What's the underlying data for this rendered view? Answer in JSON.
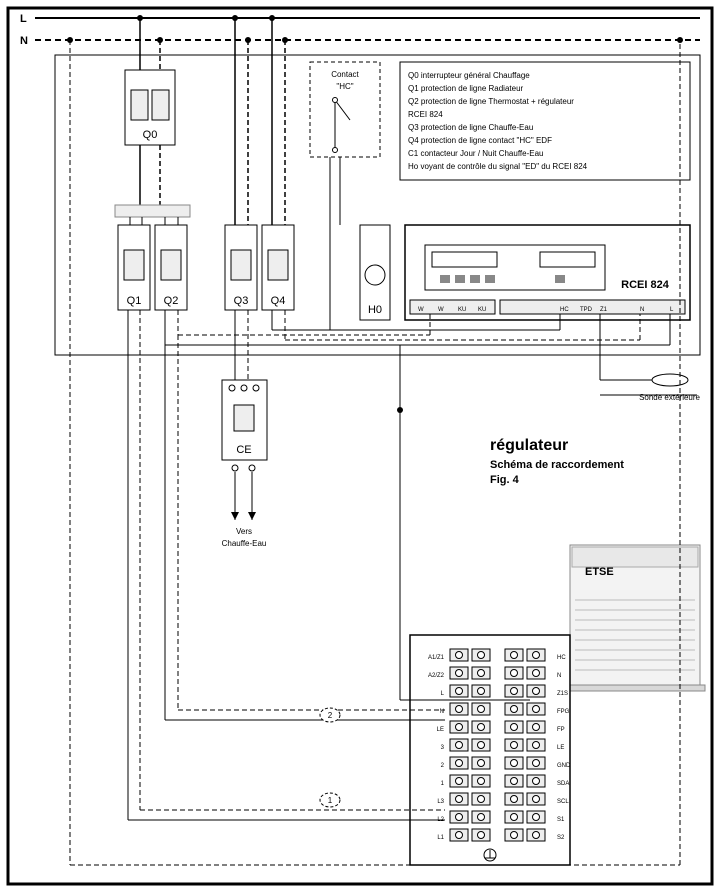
{
  "rails": {
    "L": "L",
    "N": "N"
  },
  "breakers": {
    "Q0": "Q0",
    "Q1": "Q1",
    "Q2": "Q2",
    "Q3": "Q3",
    "Q4": "Q4",
    "CE": "CE",
    "H0": "H0"
  },
  "contactHC": {
    "title1": "Contact",
    "title2": "\"HC\""
  },
  "legend": {
    "l1": "Q0  interrupteur général Chauffage",
    "l2": "Q1  protection de ligne Radiateur",
    "l3": "Q2  protection de ligne Thermostat + régulateur",
    "l4": "RCEI 824",
    "l5": "Q3  protection de ligne Chauffe-Eau",
    "l6": "Q4  protection de ligne contact \"HC\" EDF",
    "l7": "C1 contacteur Jour / Nuit Chauffe-Eau",
    "l8": "Ho voyant de contrôle du signal \"ED\" du RCEI 824"
  },
  "controller": {
    "name": "RCEI 824",
    "leftTerms": [
      "W",
      "W",
      "KU",
      "KU"
    ],
    "rightTerms": [
      "HC",
      "TPD",
      "Z1",
      "",
      "N",
      "",
      "L"
    ]
  },
  "sonde": "Sonde extérieure",
  "title": {
    "t1": "régulateur",
    "t2": "Schéma de raccordement",
    "t3": "Fig. 4"
  },
  "heater": "ETSE",
  "chauffeEau": {
    "l1": "Vers",
    "l2": "Chauffe-Eau"
  },
  "wireTags": {
    "w1": "1",
    "w2": "2"
  },
  "terminal": {
    "left": [
      "A1/Z1",
      "A2/Z2",
      "L",
      "N",
      "LE",
      "3",
      "2",
      "1",
      "L3",
      "L2",
      "L1"
    ],
    "right": [
      "HC",
      "N",
      "Z1S",
      "FPG",
      "FP",
      "LE",
      "GND",
      "SDA",
      "SCL",
      "S1",
      "S2"
    ]
  }
}
